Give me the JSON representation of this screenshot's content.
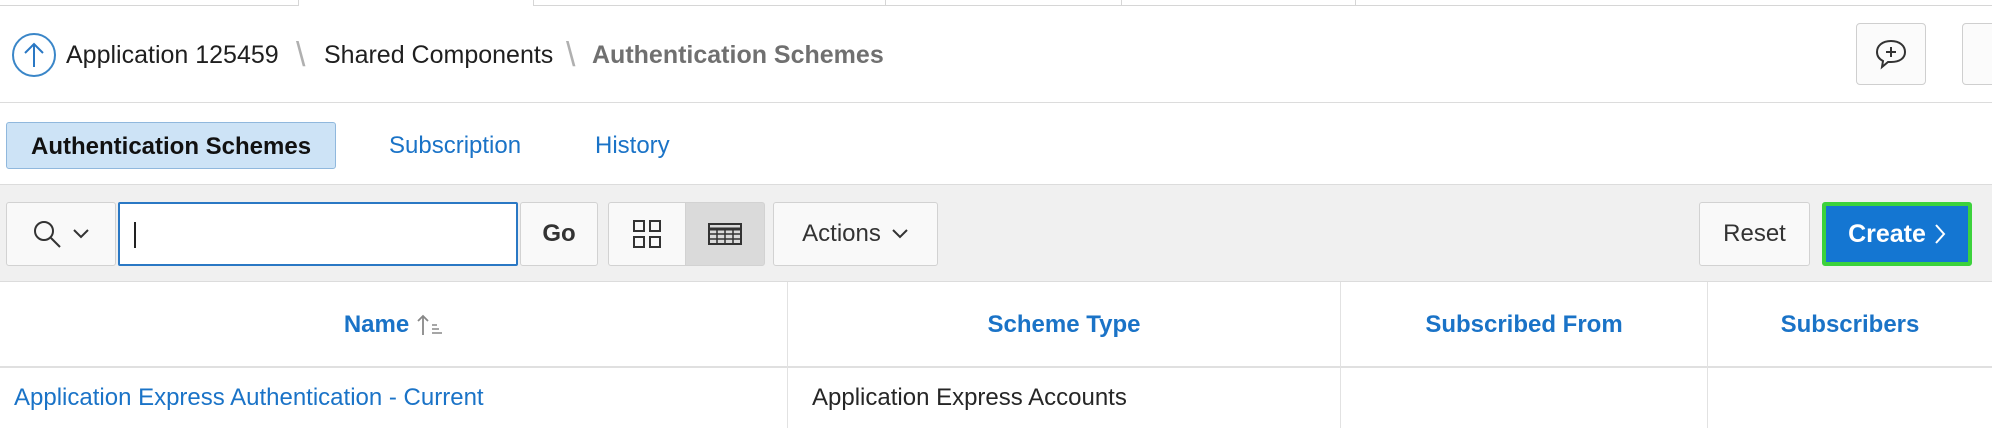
{
  "breadcrumb": {
    "items": [
      {
        "label": "Application 125459"
      },
      {
        "label": "Shared Components"
      },
      {
        "label": "Authentication Schemes"
      }
    ]
  },
  "tabs": [
    {
      "label": "Authentication Schemes",
      "active": true
    },
    {
      "label": "Subscription",
      "active": false
    },
    {
      "label": "History",
      "active": false
    }
  ],
  "toolbar": {
    "search_value": "",
    "go_label": "Go",
    "actions_label": "Actions",
    "reset_label": "Reset",
    "create_label": "Create",
    "view_mode": "report",
    "accent_color": "#1476d2",
    "highlight_color": "#3cd23c"
  },
  "table": {
    "columns": [
      {
        "label": "Name",
        "sorted": "ascending"
      },
      {
        "label": "Scheme Type"
      },
      {
        "label": "Subscribed From"
      },
      {
        "label": "Subscribers"
      }
    ],
    "rows": [
      {
        "name": "Application Express Authentication - Current",
        "scheme_type": "Application Express Accounts",
        "subscribed_from": "",
        "subscribers": ""
      }
    ]
  },
  "icons": [
    "arrow-up-icon",
    "feedback-icon",
    "search-icon",
    "chevron-down-icon",
    "grid-view-icon",
    "report-view-icon",
    "chevron-right-icon",
    "sort-ascending-icon"
  ]
}
